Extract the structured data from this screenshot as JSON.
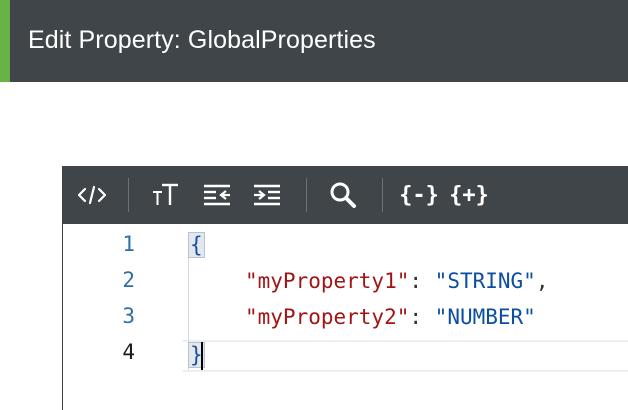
{
  "header": {
    "title": "Edit Property: GlobalProperties",
    "accent_color": "#67b346",
    "background": "#3f4548"
  },
  "toolbar": {
    "items": [
      {
        "icon": "code-view-icon"
      },
      {
        "icon": "text-size-icon"
      },
      {
        "icon": "outdent-icon"
      },
      {
        "icon": "indent-icon"
      },
      {
        "icon": "search-icon"
      },
      {
        "icon": "collapse-all-icon",
        "text": "{-}"
      },
      {
        "icon": "expand-all-icon",
        "text": "{+}"
      }
    ]
  },
  "editor": {
    "line_numbers": [
      "1",
      "2",
      "3",
      "4"
    ],
    "active_line": "4",
    "lines": [
      {
        "open": "{"
      },
      {
        "key": "\"myProperty1\"",
        "sep": ": ",
        "value": "\"STRING\"",
        "trail": ","
      },
      {
        "key": "\"myProperty2\"",
        "sep": ": ",
        "value": "\"NUMBER\"",
        "trail": ""
      },
      {
        "close": "}"
      }
    ],
    "colors": {
      "key": "#a31515",
      "value": "#0b4ea2",
      "line_number": "#2e6fa8"
    }
  }
}
